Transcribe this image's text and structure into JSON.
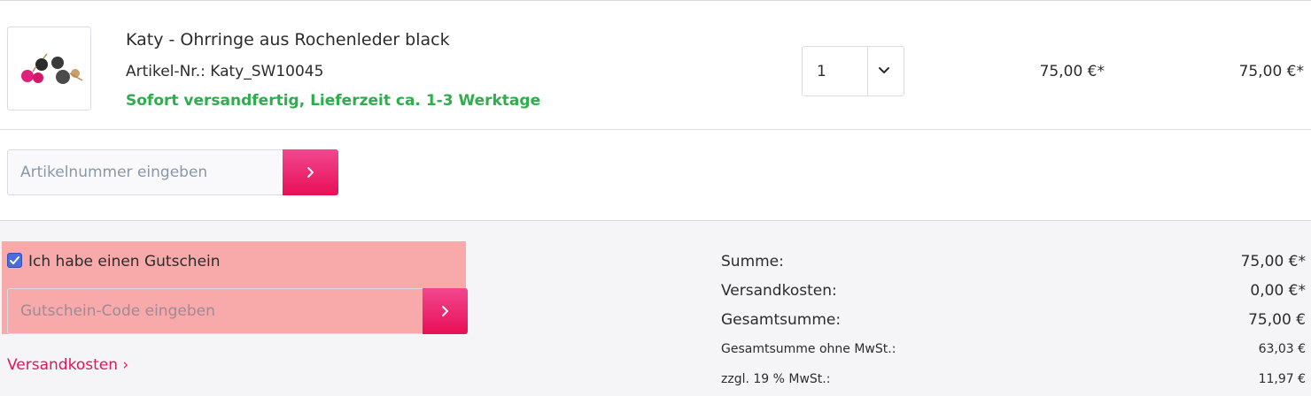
{
  "product": {
    "name": "Katy - Ohrringe aus Rochenleder black",
    "sku": "Artikel-Nr.: Katy_SW10045",
    "delivery": "Sofort versandfertig, Lieferzeit ca. 1-3 Werktage",
    "quantity": "1",
    "unit_price": "75,00 €*",
    "total_price": "75,00 €*"
  },
  "add_article": {
    "placeholder": "Artikelnummer eingeben"
  },
  "voucher": {
    "checkbox_label": "Ich habe einen Gutschein",
    "checked": true,
    "placeholder": "Gutschein-Code eingeben"
  },
  "shipping_link": "Versandkosten ›",
  "summary": [
    {
      "label": "Summe:",
      "value": "75,00 €*"
    },
    {
      "label": "Versandkosten:",
      "value": "0,00 €*"
    },
    {
      "label": "Gesamtsumme:",
      "value": "75,00 €"
    },
    {
      "label": "Gesamtsumme ohne MwSt.:",
      "value": "63,03 €"
    },
    {
      "label": "zzgl. 19 % MwSt.:",
      "value": "11,97 €"
    }
  ],
  "colors": {
    "accent_pink": "#e80f56",
    "delivery_green": "#2ead4c",
    "highlight": "#fa7878"
  },
  "icons": [
    "product-thumbnail-image",
    "chevron-down-icon",
    "arrow-right-icon",
    "checkmark-icon"
  ]
}
